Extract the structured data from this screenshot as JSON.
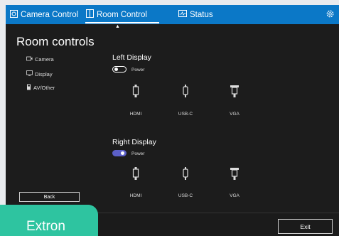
{
  "nav": {
    "tabs": [
      {
        "label": "Camera Control",
        "icon": "camera-icon"
      },
      {
        "label": "Room Control",
        "icon": "room-icon"
      },
      {
        "label": "Status",
        "icon": "status-icon"
      }
    ],
    "active": "Room Control",
    "settings_icon": "gear-icon",
    "color": "#0b78c7"
  },
  "page_title": "Room controls",
  "sidebar": {
    "items": [
      {
        "label": "Camera",
        "icon": "camera-icon"
      },
      {
        "label": "Display",
        "icon": "display-icon"
      },
      {
        "label": "AV/Other",
        "icon": "av-icon"
      }
    ],
    "back_label": "Back"
  },
  "displays": [
    {
      "title": "Left Display",
      "power_label": "Power",
      "power_on": false,
      "inputs": [
        {
          "label": "HDMI",
          "icon": "hdmi-icon"
        },
        {
          "label": "USB-C",
          "icon": "usb-c-icon"
        },
        {
          "label": "VGA",
          "icon": "vga-icon"
        }
      ]
    },
    {
      "title": "Right Display",
      "power_label": "Power",
      "power_on": true,
      "inputs": [
        {
          "label": "HDMI",
          "icon": "hdmi-icon"
        },
        {
          "label": "USB-C",
          "icon": "usb-c-icon"
        },
        {
          "label": "VGA",
          "icon": "vga-icon"
        }
      ]
    }
  ],
  "footer": {
    "exit_label": "Exit",
    "brand": "Extron",
    "brand_color": "#2ec4a0"
  }
}
